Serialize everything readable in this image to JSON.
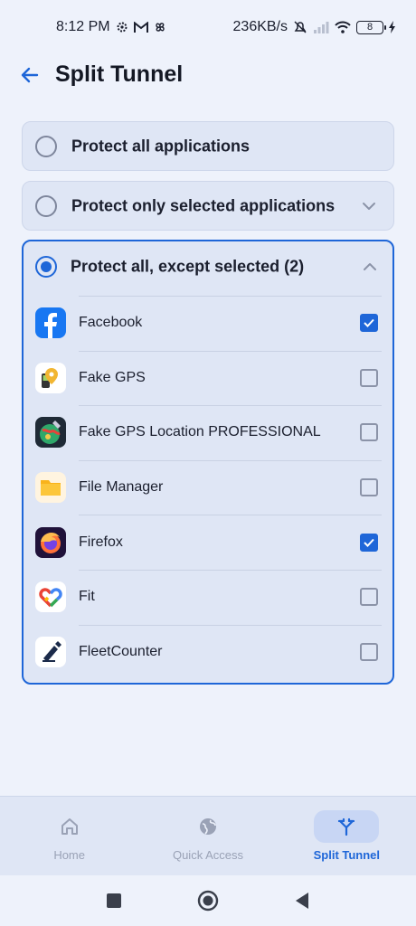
{
  "status_bar": {
    "time": "8:12 PM",
    "network_speed": "236KB/s",
    "battery_level": "8",
    "left_icons": [
      "settings-gear-icon",
      "gmail-icon",
      "pinwheel-icon"
    ],
    "right_icons": [
      "mute-icon",
      "signal-icon",
      "wifi-icon",
      "battery-icon",
      "charging-icon"
    ]
  },
  "header": {
    "title": "Split Tunnel",
    "back_icon": "arrow-left-icon"
  },
  "options": [
    {
      "label": "Protect all applications",
      "selected": false
    },
    {
      "label": "Protect only selected applications",
      "selected": false,
      "expandable": true,
      "expanded": false
    },
    {
      "label": "Protect all, except selected (2)",
      "selected": true,
      "expandable": true,
      "expanded": true
    }
  ],
  "apps": [
    {
      "name": "Facebook",
      "checked": true,
      "icon": "facebook-icon"
    },
    {
      "name": "Fake GPS",
      "checked": false,
      "icon": "fake-gps-icon"
    },
    {
      "name": "Fake GPS Location PROFESSIONAL",
      "checked": false,
      "icon": "fake-gps-pro-icon"
    },
    {
      "name": "File Manager",
      "checked": false,
      "icon": "folder-icon"
    },
    {
      "name": "Firefox",
      "checked": true,
      "icon": "firefox-icon"
    },
    {
      "name": "Fit",
      "checked": false,
      "icon": "fit-heart-icon"
    },
    {
      "name": "FleetCounter",
      "checked": false,
      "icon": "fleetcounter-icon"
    }
  ],
  "bottom_nav": [
    {
      "label": "Home",
      "icon": "home-icon",
      "active": false
    },
    {
      "label": "Quick Access",
      "icon": "globe-icon",
      "active": false
    },
    {
      "label": "Split Tunnel",
      "icon": "split-icon",
      "active": true
    }
  ],
  "colors": {
    "accent": "#1e66d8",
    "background": "#eef2fb",
    "card": "#dfe6f5"
  }
}
